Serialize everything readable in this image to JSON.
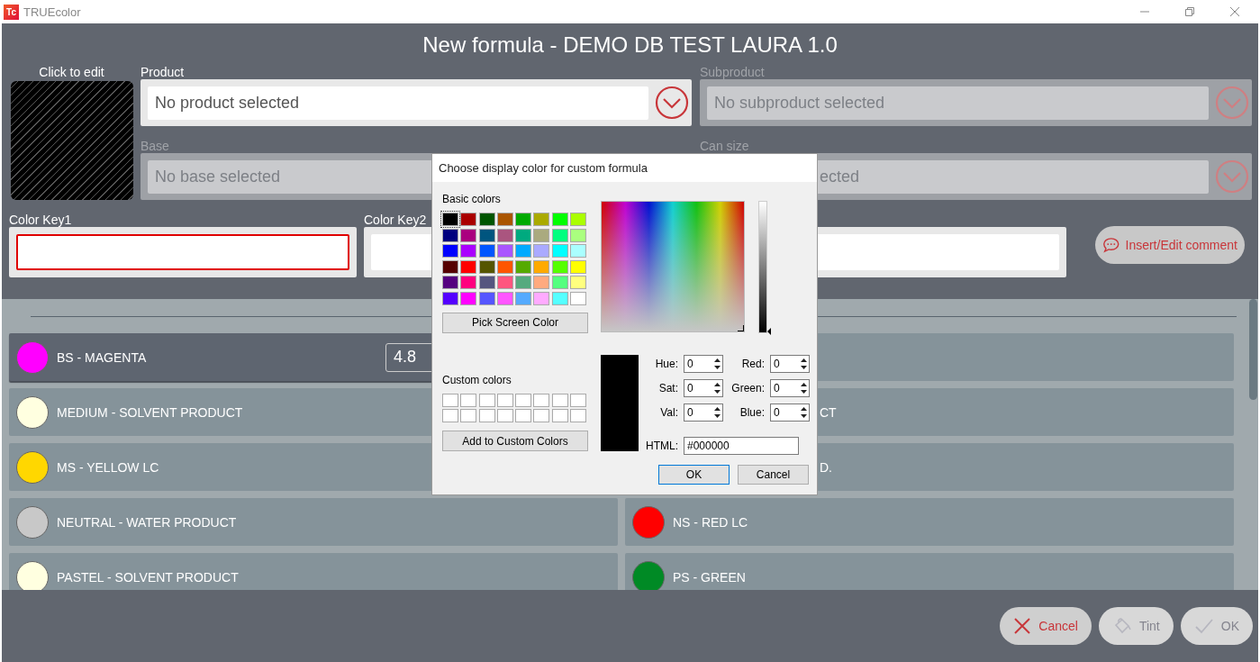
{
  "window": {
    "logo": "Tc",
    "title": "TRUEcolor"
  },
  "header": {
    "title": "New formula - DEMO DB TEST LAURA 1.0"
  },
  "swatch": {
    "label": "Click to edit"
  },
  "selectors": [
    {
      "label": "Product",
      "value": "No product selected",
      "disabled": false
    },
    {
      "label": "Subproduct",
      "value": "No subproduct selected",
      "disabled": true
    },
    {
      "label": "Base",
      "value": "No base selected",
      "disabled": true
    },
    {
      "label": "Can size",
      "value": "ected",
      "disabled": true,
      "cut_left": true
    }
  ],
  "color_keys": [
    {
      "label": "Color Key1",
      "error": true
    },
    {
      "label": "Color Key2",
      "error": false
    },
    {
      "error": false
    }
  ],
  "comment_button": {
    "label": "Insert/Edit comment"
  },
  "components": [
    {
      "name": "BS - MAGENTA",
      "color": "#ff00ff",
      "selected": true,
      "amount": "4.8"
    },
    {
      "selected": false
    },
    {
      "name": "MEDIUM - SOLVENT PRODUCT",
      "color": "#ffffe0",
      "selected": false
    },
    {
      "name": "CT",
      "selected": false,
      "cut_left": true
    },
    {
      "name": "MS - YELLOW LC",
      "color": "#ffd700",
      "selected": false
    },
    {
      "name": "D.",
      "selected": false,
      "cut_left": true
    },
    {
      "name": "NEUTRAL - WATER PRODUCT",
      "color": "#c8c8c8",
      "selected": false
    },
    {
      "name": "NS - RED LC",
      "color": "#ff0000",
      "selected": false
    },
    {
      "name": "PASTEL - SOLVENT PRODUCT",
      "color": "#ffffe0",
      "selected": false
    },
    {
      "name": "PS - GREEN",
      "color": "#008a25",
      "selected": false
    }
  ],
  "footer_buttons": [
    {
      "kind": "cancel",
      "label": "Cancel",
      "disabled": false
    },
    {
      "kind": "tint",
      "label": "Tint",
      "disabled": true
    },
    {
      "kind": "ok",
      "label": "OK",
      "disabled": true
    }
  ],
  "dialog": {
    "title": "Choose display color for custom formula",
    "basic_label": "Basic colors",
    "basic_colors": [
      {
        "color": "#000000",
        "selected": true
      },
      {
        "color": "#aa0000",
        "selected": false
      },
      {
        "color": "#005500",
        "selected": false
      },
      {
        "color": "#aa5500",
        "selected": false
      },
      {
        "color": "#00aa00",
        "selected": false
      },
      {
        "color": "#aaaa00",
        "selected": false
      },
      {
        "color": "#00ff00",
        "selected": false
      },
      {
        "color": "#aaff00",
        "selected": false
      },
      {
        "color": "#00007f",
        "selected": false
      },
      {
        "color": "#aa007f",
        "selected": false
      },
      {
        "color": "#00557f",
        "selected": false
      },
      {
        "color": "#aa557f",
        "selected": false
      },
      {
        "color": "#00aa7f",
        "selected": false
      },
      {
        "color": "#aaaa7f",
        "selected": false
      },
      {
        "color": "#00ff7f",
        "selected": false
      },
      {
        "color": "#aaff7f",
        "selected": false
      },
      {
        "color": "#0000ff",
        "selected": false
      },
      {
        "color": "#aa00ff",
        "selected": false
      },
      {
        "color": "#0055ff",
        "selected": false
      },
      {
        "color": "#aa55ff",
        "selected": false
      },
      {
        "color": "#00aaff",
        "selected": false
      },
      {
        "color": "#aaaaff",
        "selected": false
      },
      {
        "color": "#00ffff",
        "selected": false
      },
      {
        "color": "#aaffff",
        "selected": false
      },
      {
        "color": "#550000",
        "selected": false
      },
      {
        "color": "#ff0000",
        "selected": false
      },
      {
        "color": "#555500",
        "selected": false
      },
      {
        "color": "#ff5500",
        "selected": false
      },
      {
        "color": "#55aa00",
        "selected": false
      },
      {
        "color": "#ffaa00",
        "selected": false
      },
      {
        "color": "#55ff00",
        "selected": false
      },
      {
        "color": "#ffff00",
        "selected": false
      },
      {
        "color": "#55007f",
        "selected": false
      },
      {
        "color": "#ff007f",
        "selected": false
      },
      {
        "color": "#55557f",
        "selected": false
      },
      {
        "color": "#ff557f",
        "selected": false
      },
      {
        "color": "#55aa7f",
        "selected": false
      },
      {
        "color": "#ffaa7f",
        "selected": false
      },
      {
        "color": "#55ff7f",
        "selected": false
      },
      {
        "color": "#ffff7f",
        "selected": false
      },
      {
        "color": "#5500ff",
        "selected": false
      },
      {
        "color": "#ff00ff",
        "selected": false
      },
      {
        "color": "#5555ff",
        "selected": false
      },
      {
        "color": "#ff55ff",
        "selected": false
      },
      {
        "color": "#55aaff",
        "selected": false
      },
      {
        "color": "#ffaaff",
        "selected": false
      },
      {
        "color": "#55ffff",
        "selected": false
      },
      {
        "color": "#ffffff",
        "selected": false
      }
    ],
    "pick_button": "Pick Screen Color",
    "custom_label": "Custom colors",
    "custom_colors": [
      {
        "color": "#ffffff"
      },
      {
        "color": "#ffffff"
      },
      {
        "color": "#ffffff"
      },
      {
        "color": "#ffffff"
      },
      {
        "color": "#ffffff"
      },
      {
        "color": "#ffffff"
      },
      {
        "color": "#ffffff"
      },
      {
        "color": "#ffffff"
      },
      {
        "color": "#ffffff"
      },
      {
        "color": "#ffffff"
      },
      {
        "color": "#ffffff"
      },
      {
        "color": "#ffffff"
      },
      {
        "color": "#ffffff"
      },
      {
        "color": "#ffffff"
      },
      {
        "color": "#ffffff"
      },
      {
        "color": "#ffffff"
      }
    ],
    "add_button": "Add to Custom Colors",
    "value_slider": {
      "level": 0
    },
    "preview": {
      "color": "#000000"
    },
    "fields": [
      {
        "label": "Hue:",
        "value": "0"
      },
      {
        "label": "Red:",
        "value": "0"
      },
      {
        "label": "Sat:",
        "value": "0"
      },
      {
        "label": "Green:",
        "value": "0"
      },
      {
        "label": "Val:",
        "value": "0"
      },
      {
        "label": "Blue:",
        "value": "0"
      }
    ],
    "html": {
      "label": "HTML:",
      "value": "#000000"
    },
    "buttons": [
      {
        "label": "OK",
        "default": true
      },
      {
        "label": "Cancel",
        "default": false
      }
    ]
  }
}
